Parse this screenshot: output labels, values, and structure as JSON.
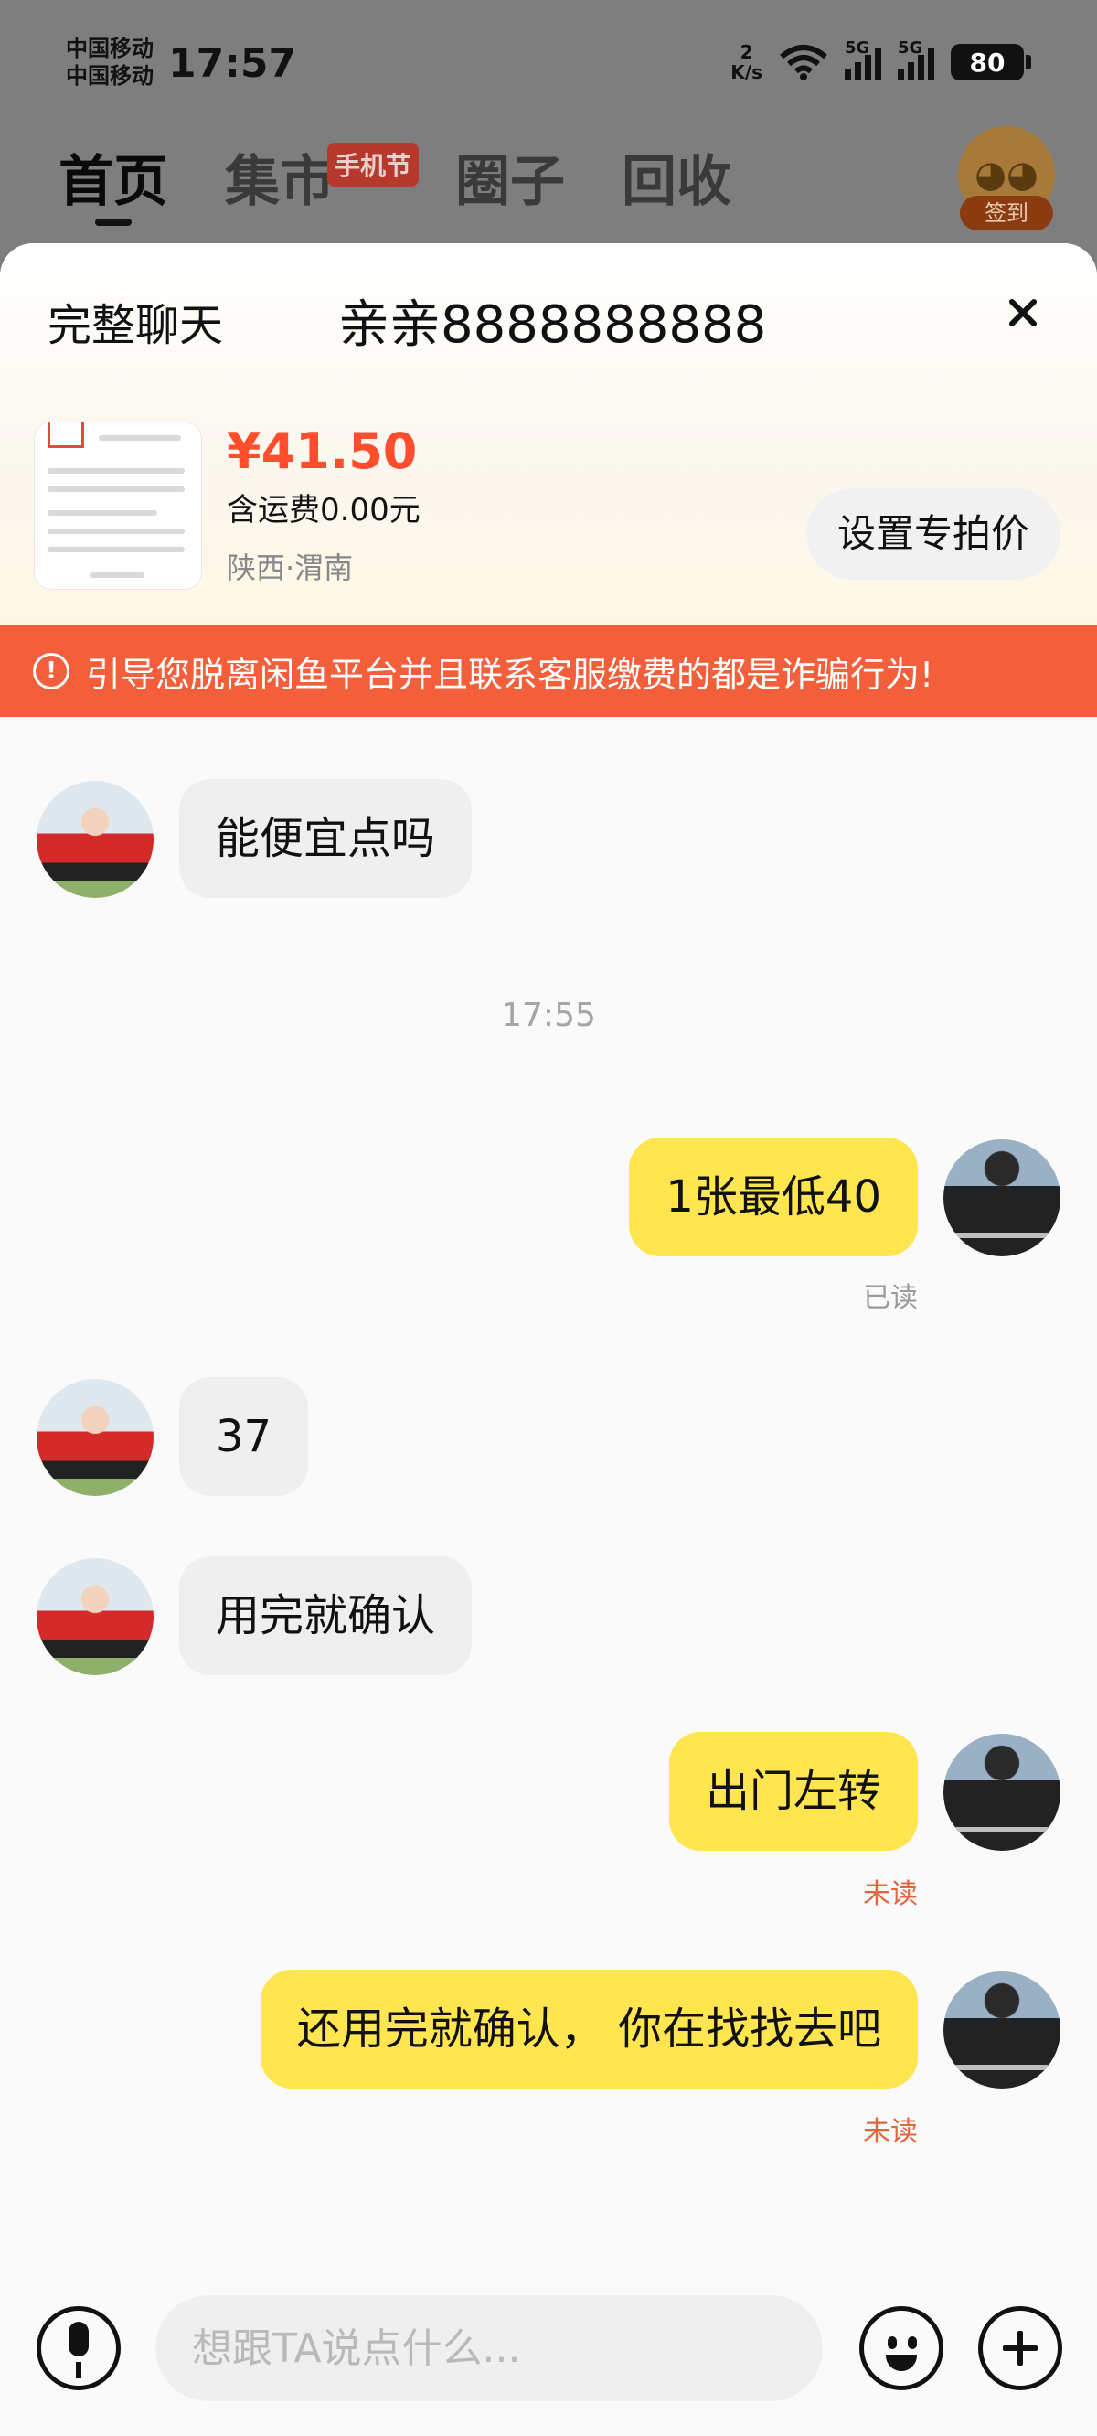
{
  "status_bar": {
    "carrier1": "中国移动",
    "carrier2": "中国移动",
    "time": "17:57",
    "net_speed_value": "2",
    "net_speed_unit": "K/s",
    "signal1": "5G",
    "signal2": "5G",
    "battery": "80"
  },
  "top_nav": {
    "tabs": [
      {
        "label": "首页"
      },
      {
        "label": "集市"
      },
      {
        "label": "圈子"
      },
      {
        "label": "回收"
      }
    ],
    "market_badge": "手机节",
    "sign_in": "签到"
  },
  "chat_header": {
    "full_chat": "完整聊天",
    "peer_name": "亲亲8888888888"
  },
  "product": {
    "price": "¥41.50",
    "shipping": "含运费0.00元",
    "location": "陕西·渭南",
    "set_price_button": "设置专拍价"
  },
  "warning": {
    "icon": "!",
    "text": "引导您脱离闲鱼平台并且联系客服缴费的都是诈骗行为!"
  },
  "messages": {
    "m1": {
      "text": "能便宜点吗"
    },
    "time_stamp": "17:55",
    "m2": {
      "text": "1张最低40",
      "status": "已读"
    },
    "m3": {
      "text": "37"
    },
    "m4": {
      "text": "用完就确认"
    },
    "m5": {
      "text": "出门左转",
      "status": "未读"
    },
    "m6": {
      "text": "还用完就确认， 你在找找去吧",
      "status": "未读"
    }
  },
  "input_bar": {
    "placeholder": "想跟TA说点什么..."
  },
  "icons": {
    "close": "close-icon",
    "mic": "microphone-icon",
    "emoji": "emoji-icon",
    "plus": "plus-icon",
    "warning": "warning-icon",
    "wifi": "wifi-icon"
  },
  "colors": {
    "accent_orange": "#f25f3a",
    "price_red": "#ff4d2d",
    "bubble_yellow": "#ffe54f",
    "unread_orange": "#e0663e"
  }
}
